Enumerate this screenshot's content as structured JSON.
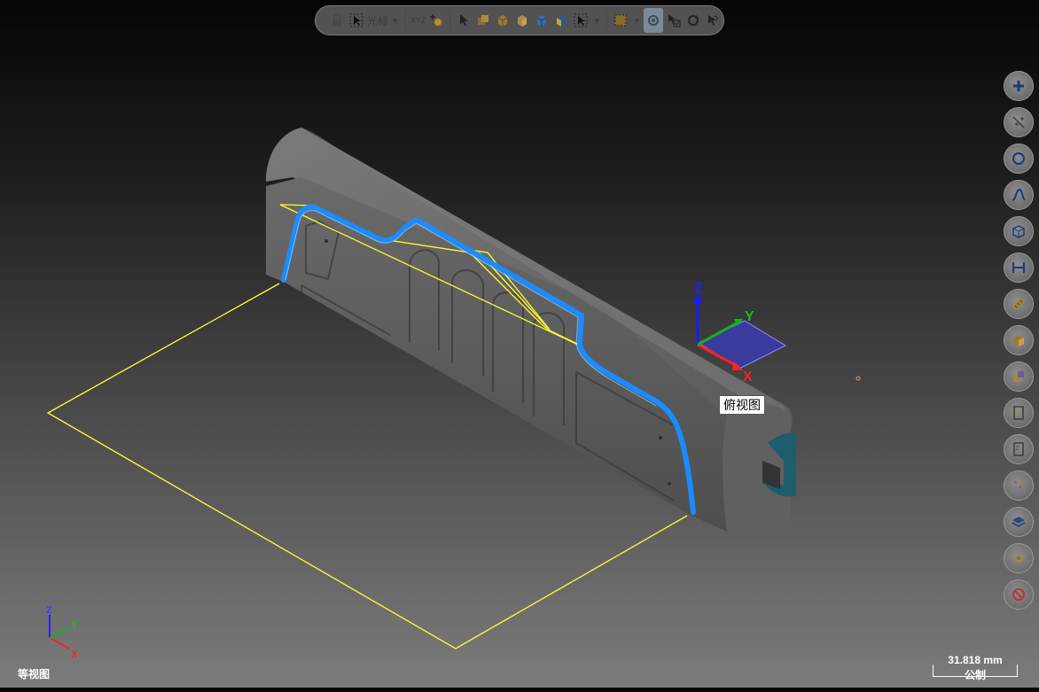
{
  "toolbar": {
    "cursor_label": "光标",
    "xyz_label": "XYZ"
  },
  "viewport": {
    "tooltip": "俯视图",
    "view_name": "等视图",
    "triad": {
      "x": "X",
      "y": "Y",
      "z": "Z"
    },
    "corner_triad": {
      "x": "X",
      "y": "Y",
      "z": "Z"
    }
  },
  "scale": {
    "value": "31.818 mm",
    "unit": "公制"
  },
  "colors": {
    "toolpath": "#1a8cff",
    "boundary": "#ffff33",
    "part": "#5c5c5c",
    "plane": "#3b3b9e"
  },
  "right_toolbar_icons": [
    "add-icon",
    "axis-icon",
    "circle-icon",
    "curve-icon",
    "box-icon",
    "measure-icon",
    "ruler-icon",
    "solid-icon",
    "surface-icon",
    "sheet-icon",
    "doc-icon",
    "grid-icon",
    "layers-icon",
    "settings-icon",
    "no-icon"
  ]
}
